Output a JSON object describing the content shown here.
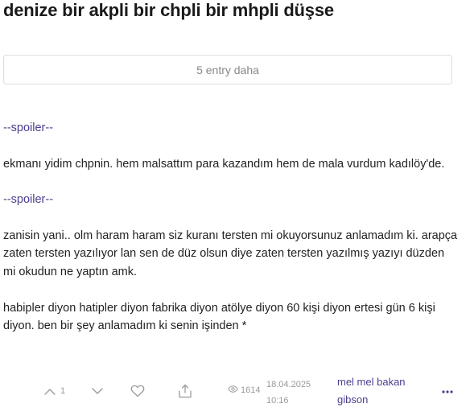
{
  "topic": {
    "title": "denize bir akpli bir chpli bir mhpli düşse"
  },
  "more_entries": {
    "label": "5 entry daha"
  },
  "entry": {
    "paragraphs": [
      {
        "type": "spoiler",
        "text": "--spoiler--"
      },
      {
        "type": "text",
        "text": "ekmanı yidim chpnin. hem malsattım para kazandım hem de mala vurdum kadılöy'de."
      },
      {
        "type": "spoiler",
        "text": "--spoiler--"
      },
      {
        "type": "text",
        "text": "zanisin yani.. olm haram haram siz kuranı tersten mi okuyorsunuz anlamadım ki. arapça zaten tersten yazılıyor lan sen de düz olsun diye zaten tersten yazılmış yazıyı düzden mi okudun ne yaptın amk."
      },
      {
        "type": "text",
        "text": "habipler diyon hatipler diyon fabrika diyon atölye diyon 60 kişi diyon ertesi gün 6 kişi diyon. ben bir şey anlamadım ki senin işinden *"
      }
    ]
  },
  "footer": {
    "upvote_count": "1",
    "views": "1614",
    "date": "18.04.2025",
    "time": "10:16",
    "author": "mel mel bakan gibson"
  },
  "icons": {
    "upvote": "chevron-up-icon",
    "downvote": "chevron-down-icon",
    "favorite": "heart-icon",
    "share": "share-icon",
    "views": "eye-icon",
    "more": "ellipsis-icon"
  },
  "colors": {
    "link": "#4a3f8f",
    "muted": "#9a9a9a",
    "title": "#1a1a1a"
  }
}
